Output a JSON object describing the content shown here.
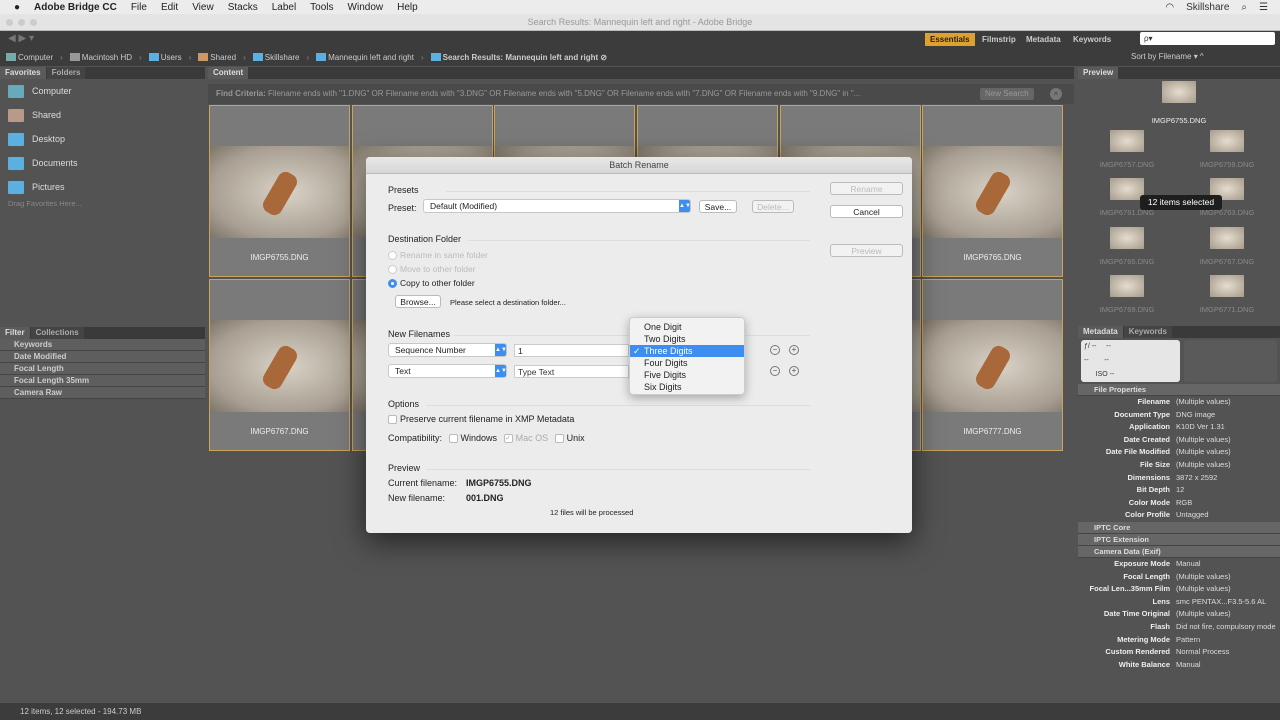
{
  "menubar": {
    "app": "Adobe Bridge CC",
    "items": [
      "File",
      "Edit",
      "View",
      "Stacks",
      "Label",
      "Tools",
      "Window",
      "Help"
    ],
    "user": "Skillshare"
  },
  "window_title": "Search Results: Mannequin left and right - Adobe Bridge",
  "workspaces": [
    "Essentials",
    "Filmstrip",
    "Metadata",
    "Keywords"
  ],
  "search": {
    "placeholder": "ρ▾"
  },
  "path": [
    "Computer",
    "Macintosh HD",
    "Users",
    "Shared",
    "Skillshare",
    "Mannequin left and right",
    "Search Results: Mannequin left and right"
  ],
  "sort_label": "Sort by Filename",
  "left": {
    "tabs": [
      "Favorites",
      "Folders"
    ],
    "favorites": [
      "Computer",
      "Shared",
      "Desktop",
      "Documents",
      "Pictures"
    ],
    "hint": "Drag Favorites Here...",
    "filter_tabs": [
      "Filter",
      "Collections"
    ],
    "filters": [
      "Keywords",
      "Date Modified",
      "Focal Length",
      "Focal Length 35mm",
      "Camera Raw"
    ]
  },
  "content": {
    "tab": "Content",
    "find_criteria_label": "Find Criteria:",
    "find_criteria": "Filename ends with \"1.DNG\" OR Filename ends with \"3.DNG\" OR Filename ends with \"5.DNG\" OR Filename ends with \"7.DNG\" OR Filename ends with \"9.DNG\" in \"...",
    "new_search": "New Search",
    "thumbs": [
      "IMGP6755.DNG",
      "",
      "",
      "",
      "",
      "IMGP6765.DNG",
      "IMGP6767.DNG",
      "",
      "",
      "",
      "",
      "IMGP6777.DNG"
    ]
  },
  "dialog": {
    "title": "Batch Rename",
    "presets_label": "Presets",
    "preset_label": "Preset:",
    "preset_value": "Default (Modified)",
    "save": "Save...",
    "delete": "Delete...",
    "rename": "Rename",
    "cancel": "Cancel",
    "preview_btn": "Preview",
    "dest_label": "Destination Folder",
    "dest_options": [
      "Rename in same folder",
      "Move to other folder",
      "Copy to other folder"
    ],
    "browse": "Browse...",
    "dest_hint": "Please select a destination folder...",
    "new_filenames": "New Filenames",
    "row1_type": "Sequence Number",
    "row1_value": "1",
    "row2_type": "Text",
    "row2_placeholder": "Type Text",
    "digits_menu": [
      "One Digit",
      "Two Digits",
      "Three Digits",
      "Four Digits",
      "Five Digits",
      "Six Digits"
    ],
    "digits_selected": "Three Digits",
    "options_label": "Options",
    "preserve": "Preserve current filename in XMP Metadata",
    "compat_label": "Compatibility:",
    "compat": [
      "Windows",
      "Mac OS",
      "Unix"
    ],
    "preview_label": "Preview",
    "current_label": "Current filename:",
    "current_value": "IMGP6755.DNG",
    "new_label": "New filename:",
    "new_value": "001.DNG",
    "files_note": "12 files will be processed"
  },
  "right": {
    "preview_tab": "Preview",
    "preview_names": [
      "IMGP6755.DNG",
      "IMGP6757.DNG",
      "IMGP6759.DNG",
      "IMGP6761.DNG",
      "IMGP6763.DNG",
      "IMGP6765.DNG",
      "IMGP6767.DNG",
      "IMGP6769.DNG",
      "IMGP6771.DNG"
    ],
    "tooltip": "12 items selected",
    "meta_tabs": [
      "Metadata",
      "Keywords"
    ],
    "file_props_label": "File Properties",
    "file_props": [
      [
        "Filename",
        "(Multiple values)"
      ],
      [
        "Document Type",
        "DNG image"
      ],
      [
        "Application",
        "K10D Ver 1.31"
      ],
      [
        "Date Created",
        "(Multiple values)"
      ],
      [
        "Date File Modified",
        "(Multiple values)"
      ],
      [
        "File Size",
        "(Multiple values)"
      ],
      [
        "Dimensions",
        "3872 x 2592"
      ],
      [
        "Bit Depth",
        "12"
      ],
      [
        "Color Mode",
        "RGB"
      ],
      [
        "Color Profile",
        "Untagged"
      ]
    ],
    "iptc_core": "IPTC Core",
    "iptc_ext": "IPTC Extension",
    "camera_label": "Camera Data (Exif)",
    "camera": [
      [
        "Exposure Mode",
        "Manual"
      ],
      [
        "Focal Length",
        "(Multiple values)"
      ],
      [
        "Focal Len...35mm Film",
        "(Multiple values)"
      ],
      [
        "Lens",
        "smc PENTAX...F3.5-5.6 AL"
      ],
      [
        "Date Time Original",
        "(Multiple values)"
      ],
      [
        "Flash",
        "Did not fire, compulsory mode"
      ],
      [
        "Metering Mode",
        "Pattern"
      ],
      [
        "Custom Rendered",
        "Normal Process"
      ],
      [
        "White Balance",
        "Manual"
      ]
    ]
  },
  "status": "12 items, 12 selected - 194.73 MB",
  "colors": {
    "accent": "#e0a02c",
    "select_blue": "#3d8ef0"
  }
}
